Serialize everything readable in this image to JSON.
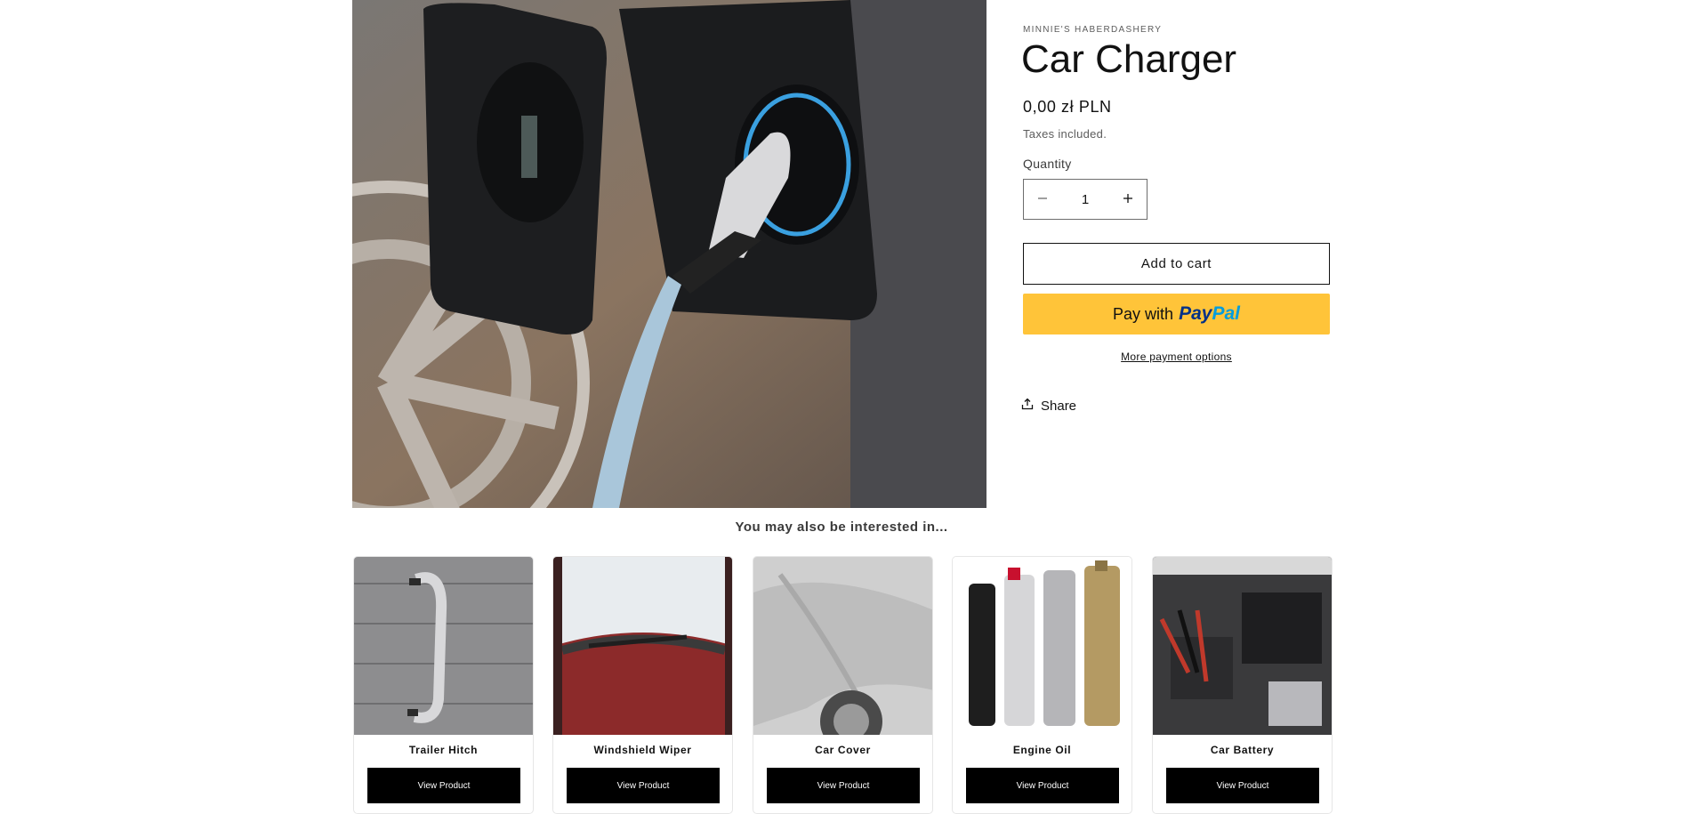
{
  "product": {
    "vendor": "MINNIE'S HABERDASHERY",
    "title": "Car Charger",
    "price": "0,00 zł PLN",
    "taxes_note": "Taxes included.",
    "quantity_label": "Quantity",
    "quantity_value": "1",
    "add_to_cart": "Add to cart",
    "paypal_prefix": "Pay with",
    "paypal_brand_1": "Pay",
    "paypal_brand_2": "Pal",
    "more_payment": "More payment options",
    "share": "Share"
  },
  "related": {
    "heading": "You may also be interested in...",
    "items": [
      {
        "name": "Trailer Hitch",
        "button": "View Product"
      },
      {
        "name": "Windshield Wiper",
        "button": "View Product"
      },
      {
        "name": "Car Cover",
        "button": "View Product"
      },
      {
        "name": "Engine Oil",
        "button": "View Product"
      },
      {
        "name": "Car Battery",
        "button": "View Product"
      }
    ]
  },
  "icons": {
    "minus": "minus-icon",
    "plus": "plus-icon",
    "share": "share-icon"
  },
  "colors": {
    "paypal_yellow": "#ffc439",
    "paypal_dark_blue": "#003087",
    "paypal_light_blue": "#009cde",
    "button_black": "#000000"
  }
}
